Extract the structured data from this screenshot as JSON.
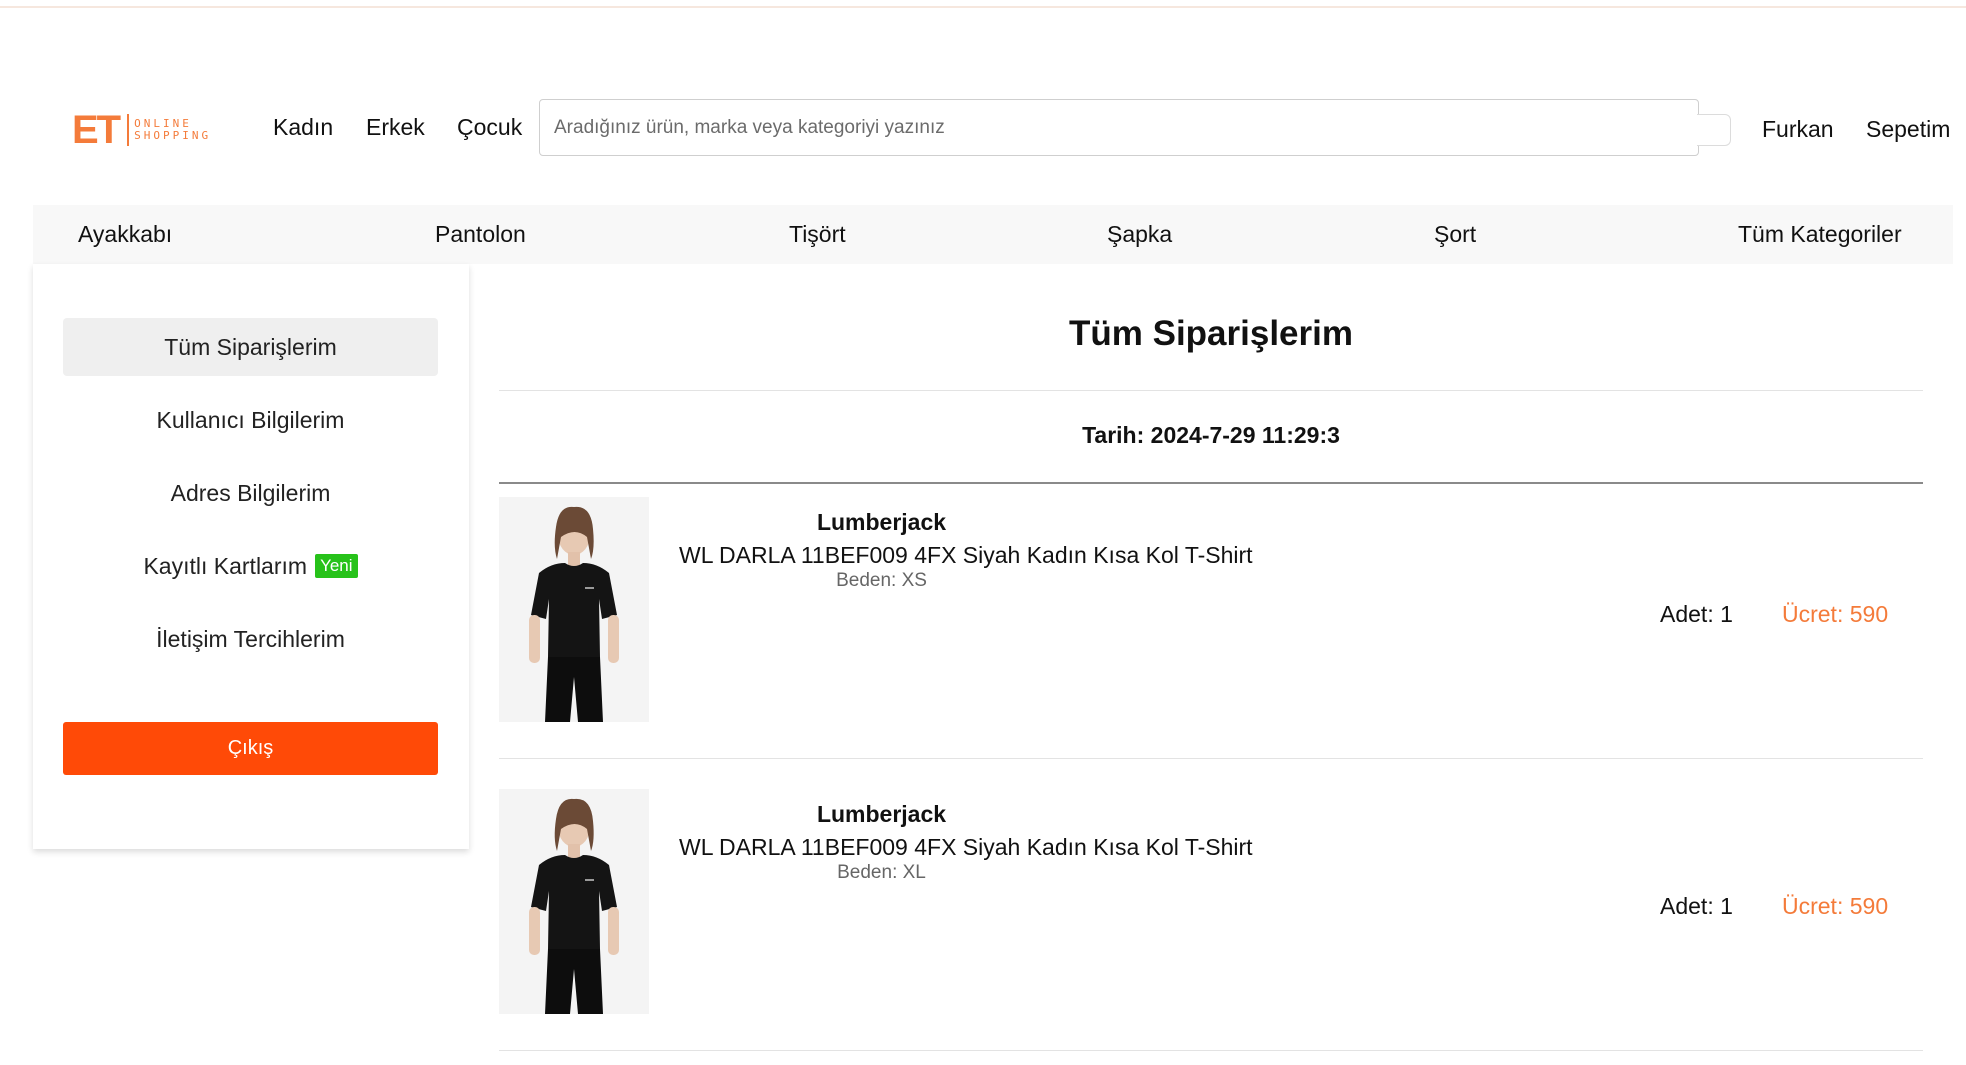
{
  "brand": {
    "logo_mark": "ET",
    "logo_line1": "ONLINE",
    "logo_line2": "SHOPPING",
    "accent_color": "#f47b3a"
  },
  "header": {
    "nav": [
      "Kadın",
      "Erkek",
      "Çocuk"
    ],
    "search_placeholder": "Aradığınız ürün, marka veya kategoriyi yazınız",
    "user_name": "Furkan",
    "cart_label": "Sepetim"
  },
  "categories": [
    "Ayakkabı",
    "Pantolon",
    "Tişört",
    "Şapka",
    "Şort",
    "Tüm Kategoriler"
  ],
  "sidebar": {
    "items": [
      {
        "label": "Tüm Siparişlerim",
        "active": true
      },
      {
        "label": "Kullanıcı Bilgilerim"
      },
      {
        "label": "Adres Bilgilerim"
      },
      {
        "label": "Kayıtlı Kartlarım",
        "badge": "Yeni"
      },
      {
        "label": "İletişim Tercihlerim"
      }
    ],
    "logout_label": "Çıkış",
    "logout_color": "#ff4a07",
    "badge_color": "#27c21a"
  },
  "main": {
    "title": "Tüm Siparişlerim",
    "order_date": "Tarih: 2024-7-29 11:29:3",
    "items": [
      {
        "brand": "Lumberjack",
        "name": "WL DARLA 11BEF009 4FX Siyah Kadın Kısa Kol T-Shirt",
        "size": "Beden: XS",
        "qty": "Adet: 1",
        "price": "Ücret: 590"
      },
      {
        "brand": "Lumberjack",
        "name": "WL DARLA 11BEF009 4FX Siyah Kadın Kısa Kol T-Shirt",
        "size": "Beden: XL",
        "qty": "Adet: 1",
        "price": "Ücret: 590"
      }
    ]
  }
}
